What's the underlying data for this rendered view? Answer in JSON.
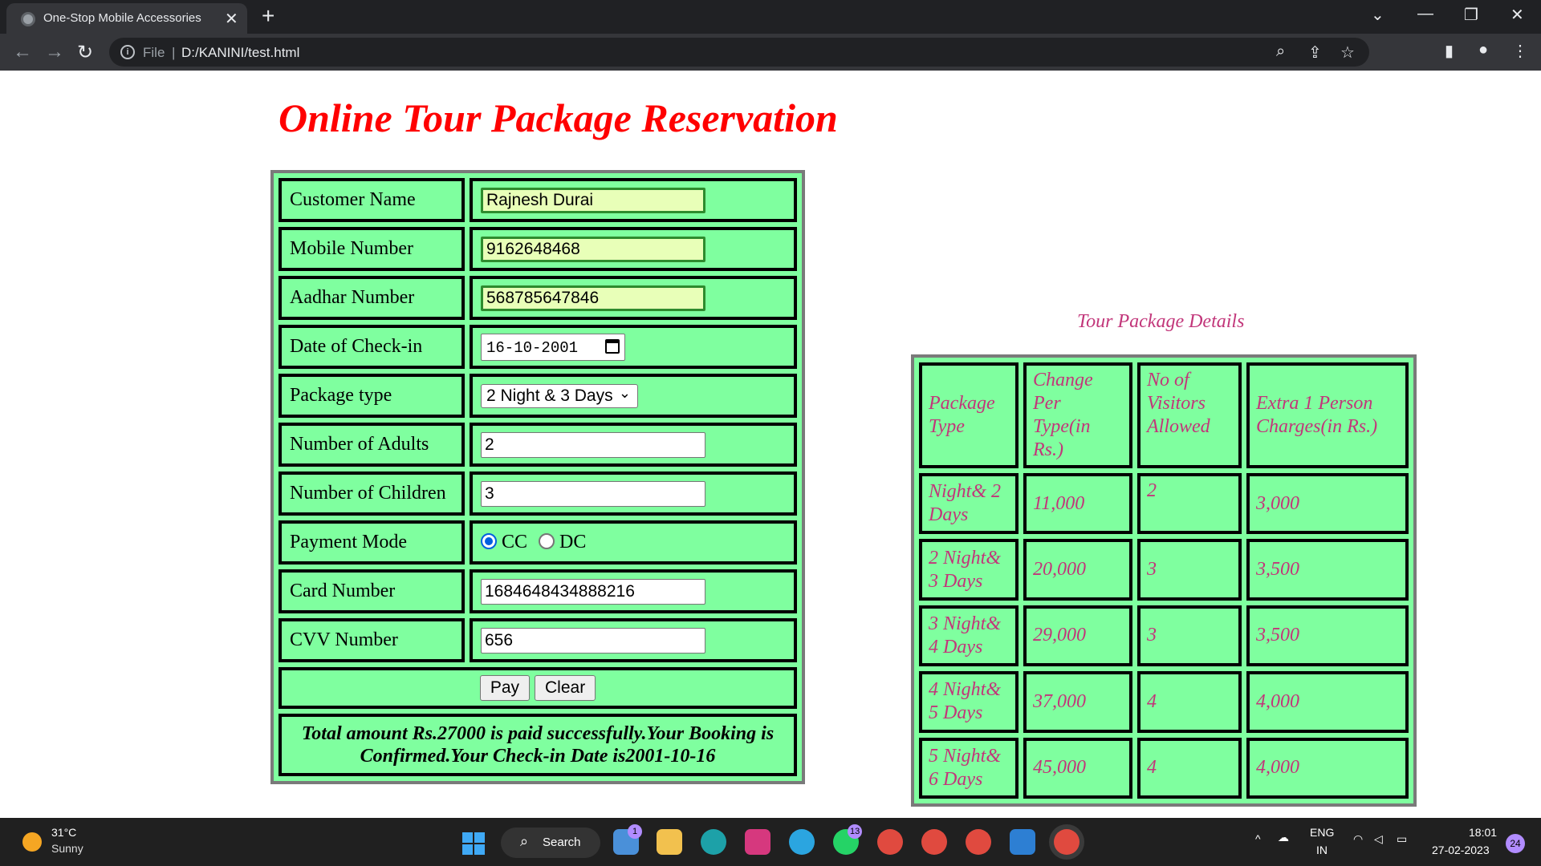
{
  "browser": {
    "tab_title": "One-Stop Mobile Accessories",
    "url_prefix": "File",
    "url": "D:/KANINI/test.html"
  },
  "page": {
    "title": "Online Tour Package Reservation"
  },
  "form": {
    "customer_name_label": "Customer Name",
    "customer_name_value": "Rajnesh Durai",
    "mobile_label": "Mobile Number",
    "mobile_value": "9162648468",
    "aadhar_label": "Aadhar Number",
    "aadhar_value": "568785647846",
    "checkin_label": "Date of Check-in",
    "checkin_value": "16-10-2001",
    "package_label": "Package type",
    "package_value": "2 Night & 3 Days",
    "adults_label": "Number of Adults",
    "adults_value": "2",
    "children_label": "Number of Children",
    "children_value": "3",
    "payment_label": "Payment Mode",
    "payment_cc": "CC",
    "payment_dc": "DC",
    "payment_selected": "CC",
    "card_label": "Card Number",
    "card_value": "1684648434888216",
    "cvv_label": "CVV Number",
    "cvv_value": "656",
    "pay_button": "Pay",
    "clear_button": "Clear",
    "success_line1": "Total amount Rs.27000 is paid successfully.Your Booking is",
    "success_line2": "Confirmed.Your Check-in Date is2001-10-16"
  },
  "details": {
    "caption": "Tour Package Details",
    "headers": {
      "package_line1": "Package",
      "package_line2": "Type",
      "charge_line1": "Change",
      "charge_line2": "Per Type(in",
      "charge_line3": "Rs.)",
      "visitors_line1": "No of",
      "visitors_line2": "Visitors",
      "visitors_line3": "Allowed",
      "extra_line1": "Extra 1 Person",
      "extra_line2": "Charges(in Rs.)"
    },
    "rows": [
      {
        "type_line1": "Night& 2",
        "type_line2": "Days",
        "charge": "11,000",
        "visitors": "2",
        "extra": "3,000"
      },
      {
        "type_line1": "2 Night&",
        "type_line2": "3 Days",
        "charge": "20,000",
        "visitors": "3",
        "extra": "3,500"
      },
      {
        "type_line1": "3 Night&",
        "type_line2": "4 Days",
        "charge": "29,000",
        "visitors": "3",
        "extra": "3,500"
      },
      {
        "type_line1": "4 Night&",
        "type_line2": "5 Days",
        "charge": "37,000",
        "visitors": "4",
        "extra": "4,000"
      },
      {
        "type_line1": "5 Night&",
        "type_line2": "6 Days",
        "charge": "45,000",
        "visitors": "4",
        "extra": "4,000"
      }
    ]
  },
  "taskbar": {
    "temperature": "31°C",
    "weather": "Sunny",
    "search_label": "Search",
    "mail_badge": "1",
    "whatsapp_badge": "13",
    "lang_line1": "ENG",
    "lang_line2": "IN",
    "time": "18:01",
    "date": "27-02-2023",
    "notification_count": "24"
  }
}
